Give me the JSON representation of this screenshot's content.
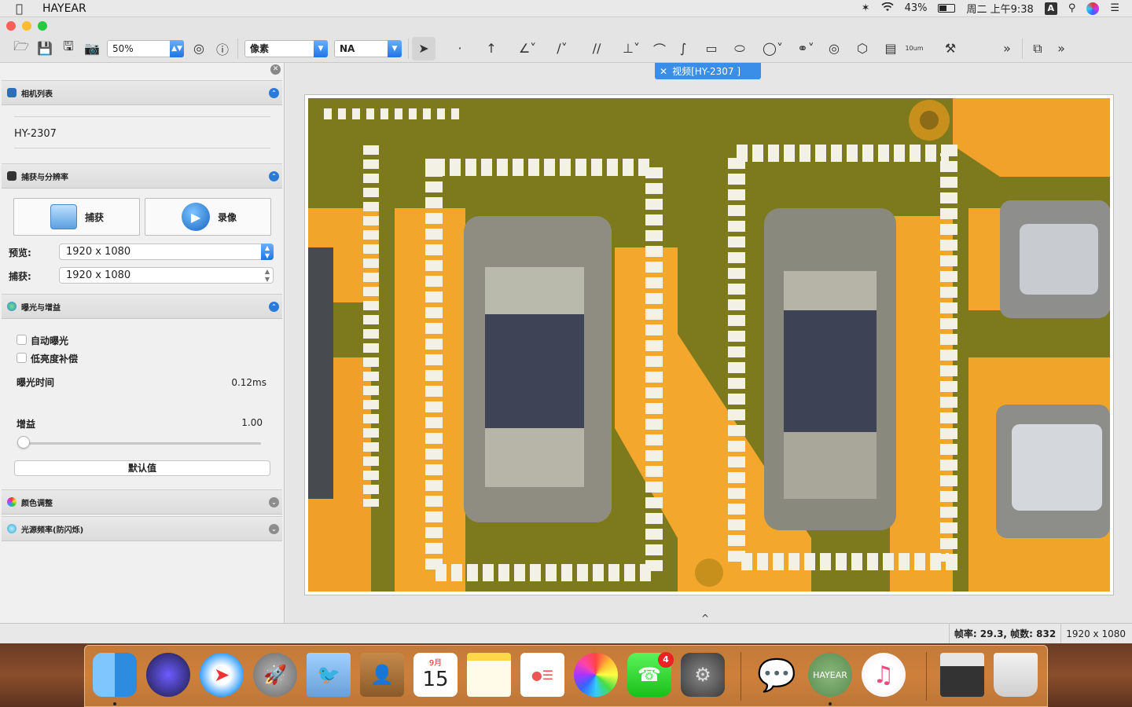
{
  "menubar": {
    "app_name": "HAYEAR",
    "battery": "43%",
    "time": "周二 上午9:38",
    "ime": "A"
  },
  "toolbar": {
    "zoom": "50%",
    "unit": "像素",
    "lens": "NA"
  },
  "left": {
    "camera_section": "相机列表",
    "camera_name": "HY-2307",
    "capture_section": "捕获与分辨率",
    "capture_btn": "捕获",
    "record_btn": "录像",
    "preview_label": "预览:",
    "preview_res": "1920 x 1080",
    "capture_label": "捕获:",
    "capture_res": "1920 x 1080",
    "exposure_section": "曝光与增益",
    "auto_exposure": "自动曝光",
    "low_light": "低亮度补偿",
    "exposure_time_label": "曝光时间",
    "exposure_time": "0.12ms",
    "gain_label": "增益",
    "gain": "1.00",
    "default_btn": "默认值",
    "color_section": "颜色调整",
    "flicker_section": "光源频率(防闪烁)"
  },
  "main": {
    "tab_title": "视频[HY-2307 ]",
    "collapse_glyph": "^"
  },
  "status": {
    "fps": "帧率: 29.3, 帧数: 832",
    "resolution": "1920 x 1080"
  },
  "dock": {
    "calendar_month": "9月",
    "calendar_day": "15",
    "facetime_badge": "4",
    "hayear_label": "HAYEAR"
  },
  "colors": {
    "accent": "#2a7ad8",
    "tab": "#3a8ee8",
    "pcb_mask": "#7c7a1c",
    "pcb_copper": "#f1a52a",
    "silkscreen": "#f3f0e6"
  }
}
